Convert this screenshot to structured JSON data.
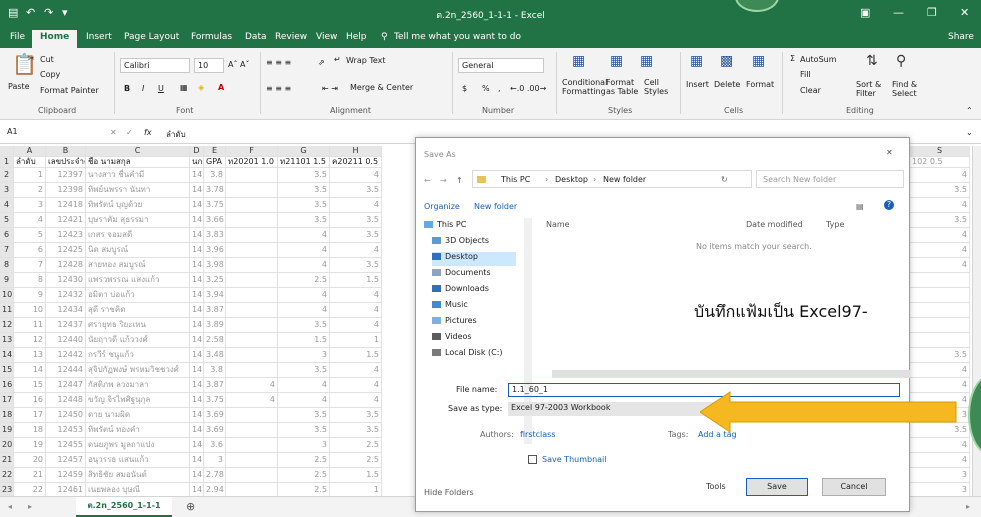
{
  "window": {
    "title": "ต.2n_2560_1-1-1 - Excel",
    "controls": [
      "▣",
      "—",
      "❐",
      "✕"
    ]
  },
  "tabs": [
    "File",
    "Home",
    "Insert",
    "Page Layout",
    "Formulas",
    "Data",
    "Review",
    "View",
    "Help"
  ],
  "tell_me": "Tell me what you want to do",
  "share": "Share",
  "ribbon": {
    "clipboard": {
      "paste": "Paste",
      "cut": "Cut",
      "copy": "Copy",
      "format_painter": "Format Painter",
      "label": "Clipboard"
    },
    "font": {
      "name": "Calibri",
      "size": "10",
      "bold": "B",
      "italic": "I",
      "underline": "U",
      "label": "Font"
    },
    "alignment": {
      "wrap": "Wrap Text",
      "merge": "Merge & Center",
      "label": "Alignment"
    },
    "number": {
      "format": "General",
      "currency": "$",
      "percent": "%",
      "comma": ",",
      "label": "Number"
    },
    "styles": {
      "conditional": "Conditional Formatting",
      "table": "Format as Table",
      "cell": "Cell Styles",
      "label": "Styles"
    },
    "cells": {
      "insert": "Insert",
      "delete": "Delete",
      "format": "Format",
      "label": "Cells"
    },
    "editing": {
      "autosum": "AutoSum",
      "fill": "Fill",
      "clear": "Clear",
      "sort": "Sort & Filter",
      "find": "Find & Select",
      "label": "Editing"
    }
  },
  "formula_bar": {
    "cell_ref": "A1",
    "fx": "fx",
    "value": "ลำดับ"
  },
  "columns": [
    "A",
    "B",
    "C",
    "D",
    "E",
    "F",
    "G",
    "H"
  ],
  "right_columns": [
    "S"
  ],
  "header_row": [
    "ลำดับ",
    "เลขประจำตัว",
    "ชื่อ นามสกุล",
    "นก",
    "GPA",
    "ท20201 1.0",
    "ท21101 1.5",
    "ค20211 0.5"
  ],
  "right_header": "102 0.5",
  "rows": [
    {
      "n": "2",
      "a": "1",
      "b": "12397",
      "c": "นางสาว ชื่นคำมี",
      "d": "14",
      "e": "3.8",
      "g": "3.5",
      "h": "4",
      "s": "4"
    },
    {
      "n": "3",
      "a": "2",
      "b": "12398",
      "c": "ทิพย์นพรรา นันทา",
      "d": "14",
      "e": "3.78",
      "g": "3.5",
      "h": "3.5",
      "s": "3.5"
    },
    {
      "n": "4",
      "a": "3",
      "b": "12418",
      "c": "ทิพรัตน์ บุญด้วย",
      "d": "14",
      "e": "3.75",
      "g": "3.5",
      "h": "4",
      "s": "4"
    },
    {
      "n": "5",
      "a": "4",
      "b": "12421",
      "c": "บุษราคัม สุธรรมา",
      "d": "14",
      "e": "3.66",
      "g": "3.5",
      "h": "3.5",
      "s": "3.5"
    },
    {
      "n": "6",
      "a": "5",
      "b": "12423",
      "c": "เกสร จอมสดี",
      "d": "14",
      "e": "3.83",
      "g": "4",
      "h": "3.5",
      "s": "4"
    },
    {
      "n": "7",
      "a": "6",
      "b": "12425",
      "c": "นิด สมบูรณ์",
      "d": "14",
      "e": "3.96",
      "g": "4",
      "h": "4",
      "s": "4"
    },
    {
      "n": "8",
      "a": "7",
      "b": "12428",
      "c": "สายทอง สมบูรณ์",
      "d": "14",
      "e": "3.98",
      "g": "4",
      "h": "3.5",
      "s": "4"
    },
    {
      "n": "9",
      "a": "8",
      "b": "12430",
      "c": "แพรวพรรณ แสงแก้ว",
      "d": "14",
      "e": "3.25",
      "g": "2.5",
      "h": "1.5",
      "s": ""
    },
    {
      "n": "10",
      "a": "9",
      "b": "12432",
      "c": "อมิตา บ่อแก้ว",
      "d": "14",
      "e": "3.94",
      "g": "4",
      "h": "4",
      "s": ""
    },
    {
      "n": "11",
      "a": "10",
      "b": "12434",
      "c": "สุดี ราชคิด",
      "d": "14",
      "e": "3.87",
      "g": "4",
      "h": "4",
      "s": ""
    },
    {
      "n": "12",
      "a": "11",
      "b": "12437",
      "c": "ศรายุทธ ริยะเทน",
      "d": "14",
      "e": "3.89",
      "g": "3.5",
      "h": "4",
      "s": ""
    },
    {
      "n": "13",
      "a": "12",
      "b": "12440",
      "c": "นัยฤาวดี แก้ววงศ์",
      "d": "14",
      "e": "2.58",
      "g": "1.5",
      "h": "1",
      "s": ""
    },
    {
      "n": "14",
      "a": "13",
      "b": "12442",
      "c": "กรวีร์ ชนูแก้ว",
      "d": "14",
      "e": "3.48",
      "g": "3",
      "h": "1.5",
      "s": "3.5"
    },
    {
      "n": "15",
      "a": "14",
      "b": "12444",
      "c": "สุจิปกัฏพงษ์ พรหมวิชชวงศ์",
      "d": "14",
      "e": "3.8",
      "g": "3.5",
      "h": "4",
      "s": "4"
    },
    {
      "n": "16",
      "a": "15",
      "b": "12447",
      "c": "กัสติภพ ลวงมาลา",
      "d": "14",
      "e": "3.87",
      "f": "4",
      "g": "4",
      "h": "4",
      "s": "4"
    },
    {
      "n": "17",
      "a": "16",
      "b": "12448",
      "c": "ขวัญ จิรไพศิฐนุกุล",
      "d": "14",
      "e": "3.75",
      "f": "4",
      "g": "4",
      "h": "4",
      "s": "4"
    },
    {
      "n": "18",
      "a": "17",
      "b": "12450",
      "c": "ดาย นามผิด",
      "d": "14",
      "e": "3.69",
      "g": "3.5",
      "h": "3.5",
      "s": "3"
    },
    {
      "n": "19",
      "a": "18",
      "b": "12453",
      "c": "ทิพรัตน์ ทองคำ",
      "d": "14",
      "e": "3.69",
      "g": "3.5",
      "h": "3.5",
      "s": "3.5"
    },
    {
      "n": "20",
      "a": "19",
      "b": "12455",
      "c": "ดนยภูพร มูลถาแปง",
      "d": "14",
      "e": "3.6",
      "g": "3",
      "h": "2.5",
      "s": "4"
    },
    {
      "n": "21",
      "a": "20",
      "b": "12457",
      "c": "อนุวรรธ แสนแก้ว",
      "d": "14",
      "e": "3",
      "g": "2.5",
      "h": "2.5",
      "s": "4"
    },
    {
      "n": "22",
      "a": "21",
      "b": "12459",
      "c": "สิทธิชัย สมอนันต์",
      "d": "14",
      "e": "2.78",
      "g": "2.5",
      "h": "1.5",
      "s": "3"
    },
    {
      "n": "23",
      "a": "22",
      "b": "12461",
      "c": "เนยพลอง บุษณี",
      "d": "14",
      "e": "2.94",
      "g": "2.5",
      "h": "1",
      "s": "3"
    }
  ],
  "sheet_tab": "ต.2n_2560_1-1-1",
  "dialog": {
    "title": "Save As",
    "close": "✕",
    "path": [
      "This PC",
      "Desktop",
      "New folder"
    ],
    "search_placeholder": "Search New folder",
    "organize": "Organize",
    "new_folder": "New folder",
    "col_name": "Name",
    "col_date": "Date modified",
    "col_type": "Type",
    "empty_text": "No items match your search.",
    "nav_items": [
      "This PC",
      "3D Objects",
      "Desktop",
      "Documents",
      "Downloads",
      "Music",
      "Pictures",
      "Videos",
      "Local Disk (C:)"
    ],
    "file_name_label": "File name:",
    "file_name_value": "1.1_60_1",
    "save_type_label": "Save as type:",
    "save_type_value": "Excel 97-2003 Workbook",
    "authors_label": "Authors:",
    "authors_value": "firstclass",
    "tags_label": "Tags:",
    "tags_value": "Add a tag",
    "thumbnail_label": "Save Thumbnail",
    "hide_folders": "Hide Folders",
    "tools": "Tools",
    "save": "Save",
    "cancel": "Cancel"
  },
  "annotation": "บันทึกแฟ้มเป็น Excel97-",
  "accent": "#217346",
  "arrow_color": "#f5b820"
}
